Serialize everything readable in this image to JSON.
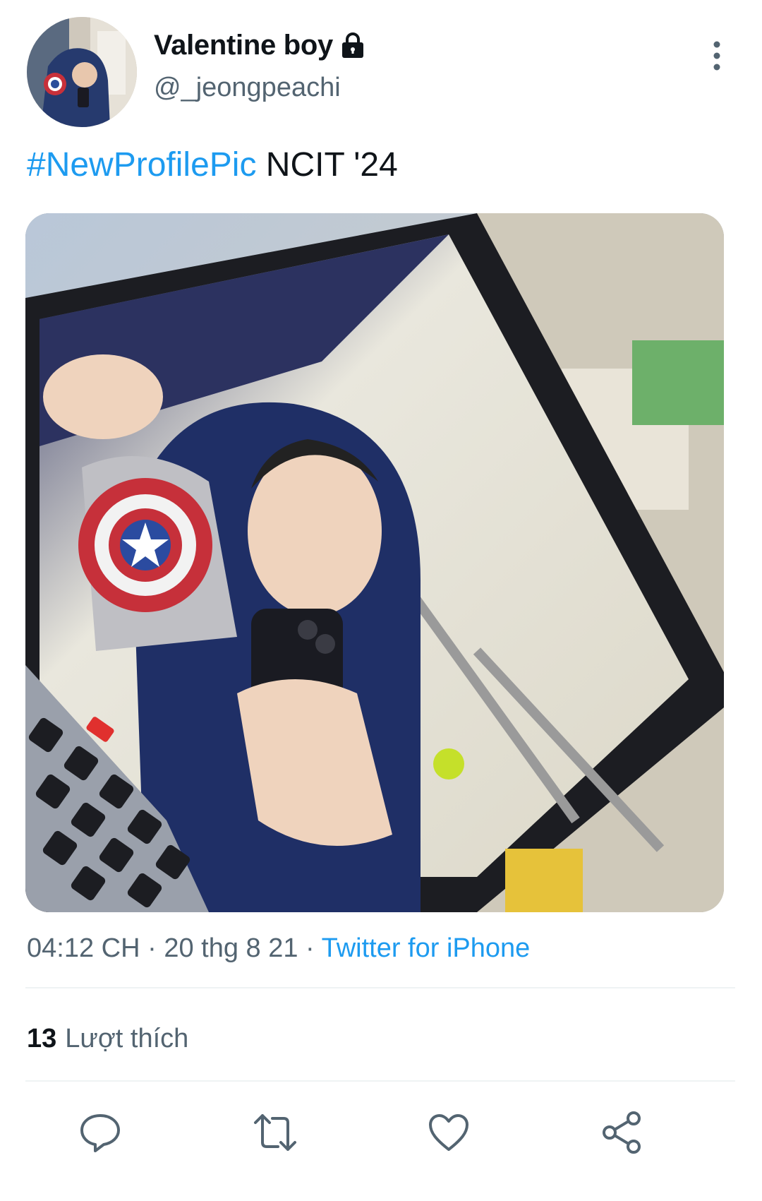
{
  "author": {
    "display_name": "Valentine boy",
    "handle": "@_jeongpeachi",
    "protected_icon": "lock-icon",
    "avatar_icon": "profile-avatar"
  },
  "tweet": {
    "hashtag": "#NewProfilePic",
    "text": " NCIT '24",
    "media_icon": "photo-mirror-selfie"
  },
  "meta": {
    "time": "04:12 CH",
    "sep1": " · ",
    "date": "20 thg 8 21",
    "sep2": " · ",
    "source": "Twitter for iPhone"
  },
  "stats": {
    "likes_count": "13",
    "likes_label": "Lượt thích"
  },
  "actions": {
    "reply_icon": "reply-icon",
    "retweet_icon": "retweet-icon",
    "like_icon": "like-icon",
    "share_icon": "share-icon"
  },
  "colors": {
    "link": "#1d9bf0",
    "secondary_text": "#536471",
    "primary_text": "#0f1419",
    "divider": "#eff3f4"
  }
}
